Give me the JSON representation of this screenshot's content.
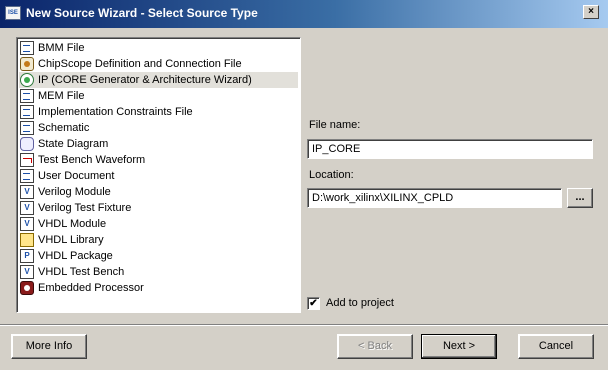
{
  "window": {
    "title": "New Source Wizard - Select Source Type",
    "app_icon_text": "ISE",
    "close_glyph": "×"
  },
  "file_types": [
    {
      "label": "BMM File",
      "icon": "doc-icon"
    },
    {
      "label": "ChipScope Definition and Connection File",
      "icon": "chipscope-icon"
    },
    {
      "label": "IP (CORE Generator & Architecture Wizard)",
      "icon": "ip-core-icon",
      "selected": true
    },
    {
      "label": "MEM File",
      "icon": "doc-icon"
    },
    {
      "label": "Implementation Constraints File",
      "icon": "doc-icon"
    },
    {
      "label": "Schematic",
      "icon": "schematic-icon"
    },
    {
      "label": "State Diagram",
      "icon": "state-diagram-icon"
    },
    {
      "label": "Test Bench Waveform",
      "icon": "waveform-icon"
    },
    {
      "label": "User Document",
      "icon": "doc-icon"
    },
    {
      "label": "Verilog Module",
      "icon": "verilog-module-icon",
      "glyph": "V"
    },
    {
      "label": "Verilog Test Fixture",
      "icon": "verilog-fixture-icon",
      "glyph": "V"
    },
    {
      "label": "VHDL Module",
      "icon": "vhdl-module-icon",
      "glyph": "V"
    },
    {
      "label": "VHDL Library",
      "icon": "library-icon"
    },
    {
      "label": "VHDL Package",
      "icon": "package-icon",
      "glyph": "P"
    },
    {
      "label": "VHDL Test Bench",
      "icon": "vhdl-testbench-icon",
      "glyph": "V"
    },
    {
      "label": "Embedded Processor",
      "icon": "processor-icon"
    }
  ],
  "form": {
    "file_name_label": "File name:",
    "file_name_value": "IP_CORE",
    "location_label": "Location:",
    "location_value": "D:\\work_xilinx\\XILINX_CPLD",
    "browse_label": "...",
    "add_to_project_label": "Add to project",
    "add_to_project_checked": true,
    "check_glyph": "✔"
  },
  "buttons": {
    "more_info": "More Info",
    "back": "< Back",
    "next": "Next >",
    "cancel": "Cancel"
  }
}
